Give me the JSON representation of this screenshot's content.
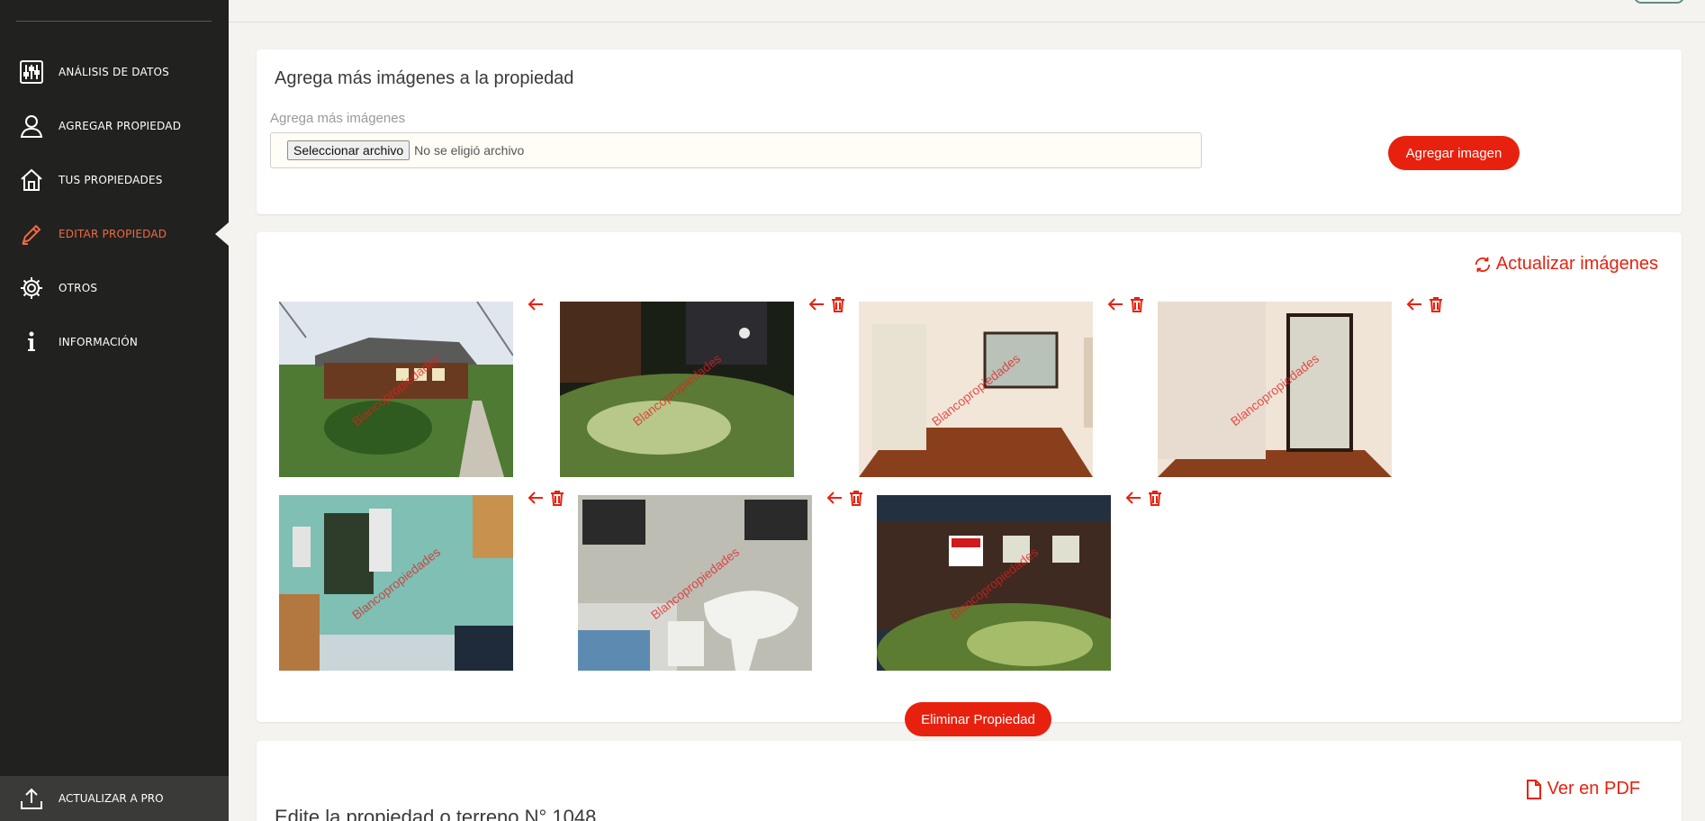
{
  "sidebar": {
    "items": [
      {
        "label": "ANÁLISIS DE DATOS",
        "icon": "sliders-icon"
      },
      {
        "label": "AGREGAR PROPIEDAD",
        "icon": "user-icon"
      },
      {
        "label": "TUS PROPIEDADES",
        "icon": "home-icon"
      },
      {
        "label": "EDITAR PROPIEDAD",
        "icon": "pencil-icon",
        "active": true
      },
      {
        "label": "OTROS",
        "icon": "gear-icon"
      },
      {
        "label": "INFORMACIÓN",
        "icon": "info-icon"
      }
    ],
    "upgrade_label": "ACTUALIZAR A PRO",
    "active_color": "#ef6b3f"
  },
  "add_images": {
    "title": "Agrega más imágenes a la propiedad",
    "field_label": "Agrega más imágenes",
    "file_button": "Seleccionar archivo",
    "file_status": "No se eligió archivo",
    "submit_label": "Agregar imagen"
  },
  "gallery": {
    "update_label": "Actualizar imágenes",
    "watermark": "Blancopropiedades",
    "images": [
      {
        "scene": "exterior-day"
      },
      {
        "scene": "garden-night"
      },
      {
        "scene": "room-curtains"
      },
      {
        "scene": "room-window"
      },
      {
        "scene": "kitchen"
      },
      {
        "scene": "bathroom"
      },
      {
        "scene": "exterior-night"
      }
    ],
    "delete_property_label": "Eliminar Propiedad"
  },
  "edit_section": {
    "pdf_label": "Ver en PDF",
    "title": "Edite la propiedad o terreno N° 1048"
  },
  "colors": {
    "accent": "#e8210f",
    "sidebar_bg": "#212120"
  }
}
